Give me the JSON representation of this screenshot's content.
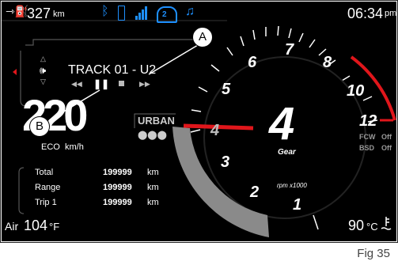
{
  "status": {
    "range": "327",
    "range_unit": "km",
    "time": "06:34",
    "time_suffix": "pm"
  },
  "media": {
    "track": "TRACK 01 - U2",
    "controls": [
      "rewind",
      "pause",
      "stop",
      "fast-forward"
    ]
  },
  "speed": {
    "value": "220",
    "mode": "ECO",
    "unit": "km/h"
  },
  "ride_mode": "URBAN",
  "gear": {
    "value": "4",
    "label": "Gear"
  },
  "rpm_unit": "rpm x1000",
  "tach_numbers": [
    "1",
    "2",
    "3",
    "4",
    "5",
    "6",
    "7",
    "8",
    "10",
    "12"
  ],
  "odometer": [
    {
      "label": "Total",
      "value": "199999",
      "unit": "km"
    },
    {
      "label": "Range",
      "value": "199999",
      "unit": "km"
    },
    {
      "label": "Trip 1",
      "value": "199999",
      "unit": "km"
    }
  ],
  "assist": [
    {
      "label": "FCW",
      "state": "Off"
    },
    {
      "label": "BSD",
      "state": "Off"
    }
  ],
  "air": {
    "label": "Air",
    "value": "104",
    "unit": "°F"
  },
  "coolant": {
    "value": "90",
    "unit": "°C"
  },
  "callouts": {
    "a": "A",
    "b": "B"
  },
  "figure_caption": "Fig 35",
  "colors": {
    "accent_red": "#e0161b",
    "icon_blue": "#1e90ff"
  }
}
